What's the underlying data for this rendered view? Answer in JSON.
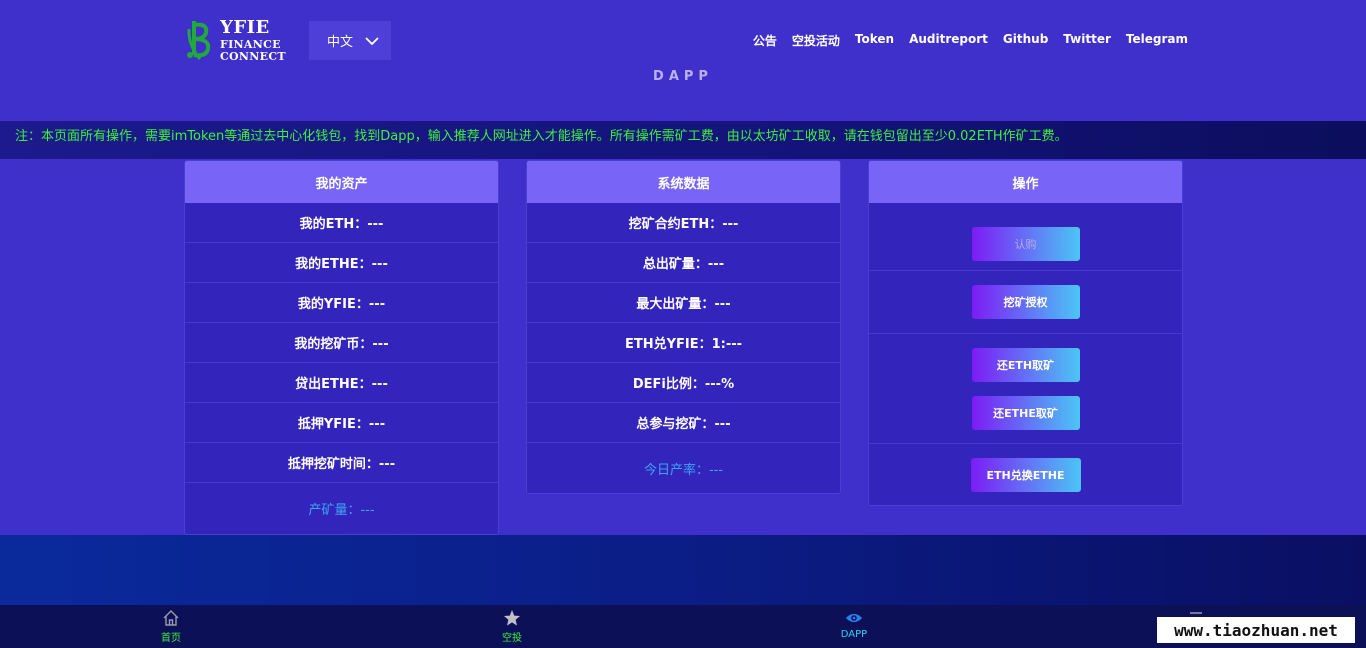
{
  "header": {
    "logo": {
      "line1": "YFIE",
      "line2": "FINANCE",
      "line3": "CONNECT"
    },
    "language": "中文",
    "nav": [
      "公告",
      "空投活动",
      "Token",
      "Auditreport",
      "Github",
      "Twitter",
      "Telegram"
    ],
    "section_title": "DAPP"
  },
  "notice": "注：本页面所有操作，需要imToken等通过去中心化钱包，找到Dapp，输入推荐人网址进入才能操作。所有操作需矿工费，由以太坊矿工收取，请在钱包留出至少0.02ETH作矿工费。",
  "assets": {
    "title": "我的资产",
    "rows": [
      "我的ETH：---",
      "我的ETHE：---",
      "我的YFIE：---",
      "我的挖矿币：---",
      "贷出ETHE：---",
      "抵押YFIE：---",
      "抵押挖矿时间：---"
    ],
    "footer": "产矿量：---"
  },
  "system": {
    "title": "系统数据",
    "rows": [
      "挖矿合约ETH：---",
      "总出矿量：---",
      "最大出矿量：---",
      "ETH兑YFIE：1:---",
      "DEFi比例：---%",
      "总参与挖矿：---"
    ],
    "footer": "今日产率：---"
  },
  "operations": {
    "title": "操作",
    "subscribe": "认购",
    "mining_auth": "挖矿授权",
    "repay_eth": "还ETH取矿",
    "repay_ethe": "还ETHE取矿",
    "exchange": "ETH兑换ETHE"
  },
  "bottom_nav": {
    "home": "首页",
    "airdrop": "空投",
    "dapp": "DAPP"
  },
  "watermark": "www.tiaozhuan.net",
  "colors": {
    "background": "#3f2fcb",
    "panel_header": "#7865f8",
    "notice_text": "#3cf23a",
    "accent_blue": "#3fa2f5"
  }
}
